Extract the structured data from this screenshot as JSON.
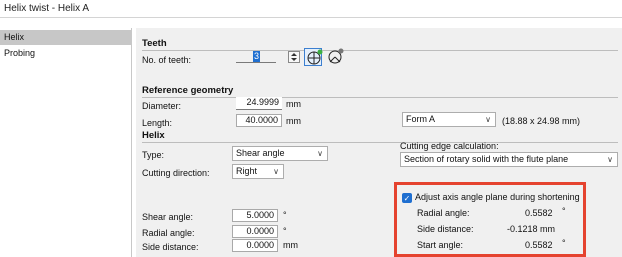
{
  "window": {
    "title": "Helix twist - Helix A"
  },
  "sidebar": {
    "items": [
      {
        "label": "Helix"
      },
      {
        "label": "Probing"
      }
    ]
  },
  "teeth": {
    "header": "Teeth",
    "no_of_teeth_label": "No. of teeth:",
    "no_of_teeth_value": "3"
  },
  "reference_geometry": {
    "header": "Reference geometry",
    "diameter_label": "Diameter:",
    "diameter_value": "24.9999",
    "diameter_unit": "mm",
    "length_label": "Length:",
    "length_value": "40.0000",
    "length_unit": "mm",
    "form_value": "Form A",
    "form_dims": "(18.88 x 24.98 mm)"
  },
  "helix": {
    "header": "Helix",
    "type_label": "Type:",
    "type_value": "Shear angle",
    "cutting_direction_label": "Cutting direction:",
    "cutting_direction_value": "Right",
    "cutting_edge_calc_label": "Cutting edge calculation:",
    "cutting_edge_calc_value": "Section of rotary solid with the flute plane",
    "shear_angle_label": "Shear angle:",
    "shear_angle_value": "5.0000",
    "shear_angle_unit": "°",
    "radial_angle_label": "Radial angle:",
    "radial_angle_value": "0.0000",
    "radial_angle_unit": "°",
    "side_distance_label": "Side distance:",
    "side_distance_value": "0.0000",
    "side_distance_unit": "mm"
  },
  "adjust": {
    "checkbox_label": "Adjust axis angle plane during shortening",
    "checked": true,
    "radial_angle_label": "Radial angle:",
    "radial_angle_value": "0.5582",
    "radial_angle_unit": "°",
    "side_distance_label": "Side distance:",
    "side_distance_value": "-0.1218 mm",
    "start_angle_label": "Start angle:",
    "start_angle_value": "0.5582",
    "start_angle_unit": "°"
  },
  "colors": {
    "highlight": "#e5432f",
    "checkbox": "#1f6fd0",
    "selection": "#c7c7c7"
  }
}
